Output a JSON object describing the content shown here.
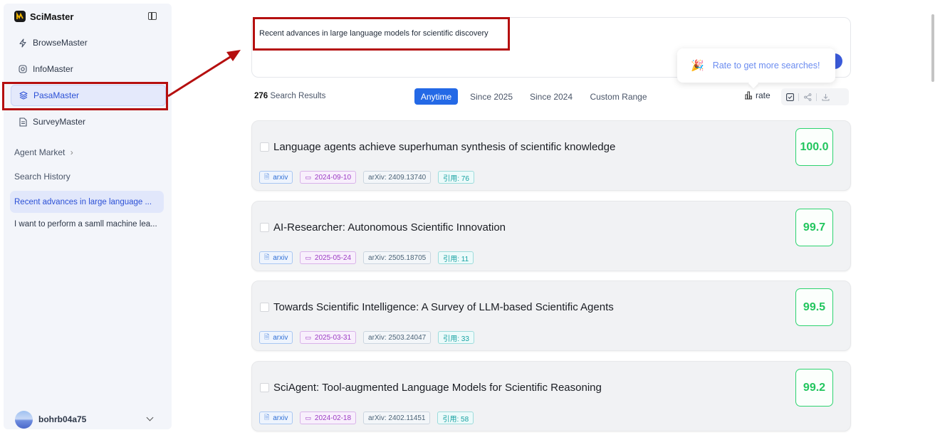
{
  "app": {
    "name": "SciMaster"
  },
  "sidebar": {
    "nav": [
      {
        "label": "BrowseMaster",
        "icon": "lightning-icon"
      },
      {
        "label": "InfoMaster",
        "icon": "globe-icon"
      },
      {
        "label": "PasaMaster",
        "icon": "layers-icon",
        "active": true
      },
      {
        "label": "SurveyMaster",
        "icon": "document-icon"
      }
    ],
    "agent_market": "Agent Market",
    "search_history_label": "Search History",
    "history": [
      {
        "label": "Recent advances in large language ...",
        "active": true
      },
      {
        "label": "I want to perform a samll machine lea..."
      }
    ],
    "user": {
      "name": "bohrb04a75"
    }
  },
  "search": {
    "query": "Recent advances in large language models for scientific discovery"
  },
  "tooltip": {
    "text": "Rate to get more searches!"
  },
  "results": {
    "count": "276",
    "count_suffix": "Search Results",
    "filters": [
      "Anytime",
      "Since 2025",
      "Since 2024",
      "Custom Range"
    ],
    "active_filter": "Anytime",
    "rate_label": "rate",
    "items": [
      {
        "title": "Language agents achieve superhuman synthesis of scientific knowledge",
        "source": "arxiv",
        "date": "2024-09-10",
        "arxiv": "arXiv: 2409.13740",
        "cite": "引用: 76",
        "score": "100.0"
      },
      {
        "title": "AI-Researcher: Autonomous Scientific Innovation",
        "source": "arxiv",
        "date": "2025-05-24",
        "arxiv": "arXiv: 2505.18705",
        "cite": "引用: 11",
        "score": "99.7"
      },
      {
        "title": "Towards Scientific Intelligence: A Survey of LLM-based Scientific Agents",
        "source": "arxiv",
        "date": "2025-03-31",
        "arxiv": "arXiv: 2503.24047",
        "cite": "引用: 33",
        "score": "99.5"
      },
      {
        "title": "SciAgent: Tool-augmented Language Models for Scientific Reasoning",
        "source": "arxiv",
        "date": "2024-02-18",
        "arxiv": "arXiv: 2402.11451",
        "cite": "引用: 58",
        "score": "99.2"
      }
    ]
  },
  "colors": {
    "accent": "#2469e6",
    "score_green": "#22c55e",
    "annotation_red": "#b50f0f"
  }
}
